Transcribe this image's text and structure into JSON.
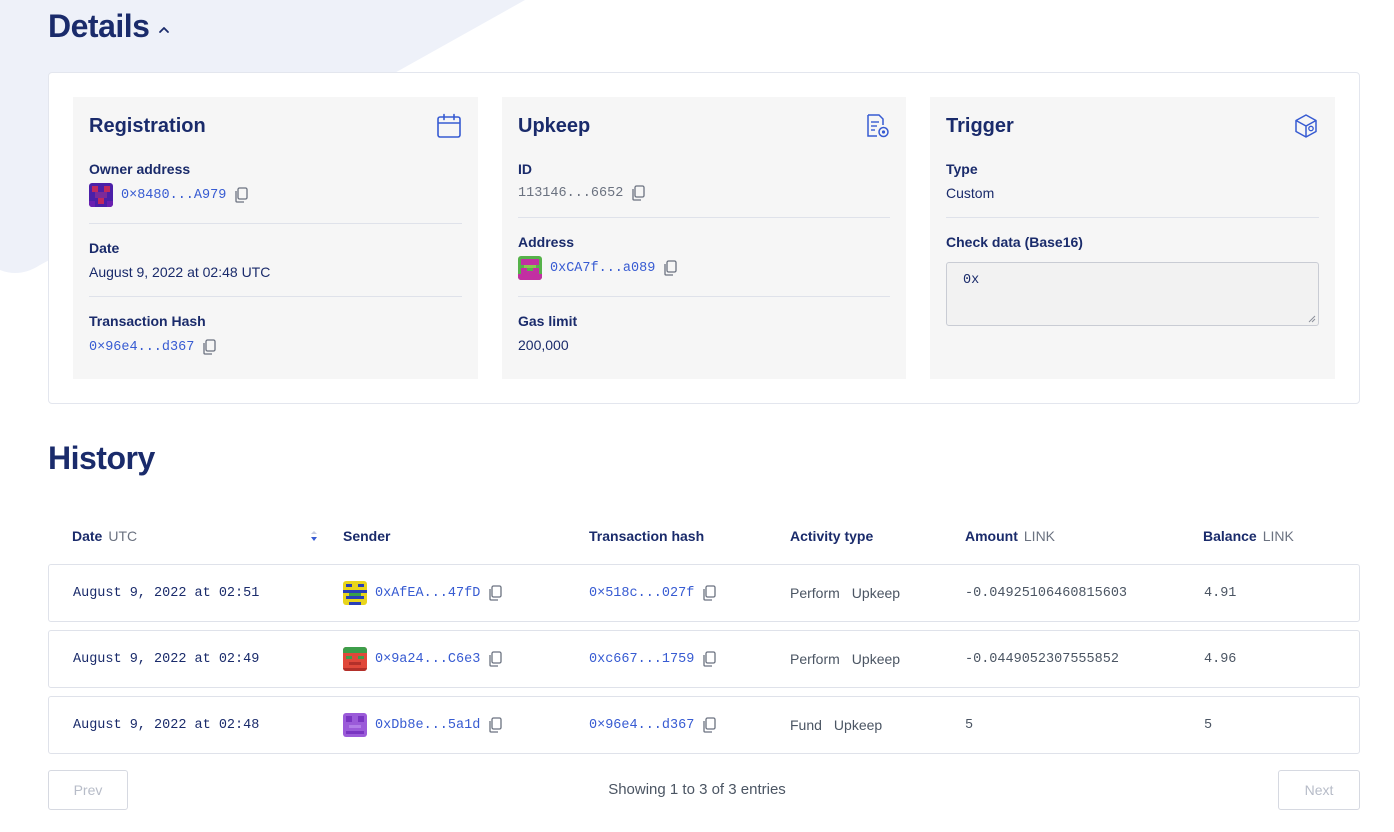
{
  "details": {
    "title": "Details",
    "registration": {
      "title": "Registration",
      "owner_label": "Owner address",
      "owner_value": "0×8480...A979",
      "date_label": "Date",
      "date_value": "August 9, 2022 at 02:48 UTC",
      "tx_label": "Transaction Hash",
      "tx_value": "0×96e4...d367"
    },
    "upkeep": {
      "title": "Upkeep",
      "id_label": "ID",
      "id_value": "113146...6652",
      "address_label": "Address",
      "address_value": "0xCA7f...a089",
      "gas_label": "Gas limit",
      "gas_value": "200,000"
    },
    "trigger": {
      "title": "Trigger",
      "type_label": "Type",
      "type_value": "Custom",
      "check_label": "Check data (Base16)",
      "check_value": "0x"
    }
  },
  "history": {
    "title": "History",
    "columns": {
      "date": "Date",
      "date_unit": "UTC",
      "sender": "Sender",
      "hash": "Transaction hash",
      "activity": "Activity type",
      "amount": "Amount",
      "amount_unit": "LINK",
      "balance": "Balance",
      "balance_unit": "LINK"
    },
    "rows": [
      {
        "date": "August 9, 2022 at 02:51",
        "sender": "0xAfEA...47fD",
        "hash": "0×518c...027f",
        "activity_1": "Perform",
        "activity_2": "Upkeep",
        "amount": "-0.04925106460815603",
        "balance": "4.91"
      },
      {
        "date": "August 9, 2022 at 02:49",
        "sender": "0×9a24...C6e3",
        "hash": "0xc667...1759",
        "activity_1": "Perform",
        "activity_2": "Upkeep",
        "amount": "-0.0449052307555852",
        "balance": "4.96"
      },
      {
        "date": "August 9, 2022 at 02:48",
        "sender": "0xDb8e...5a1d",
        "hash": "0×96e4...d367",
        "activity_1": "Fund",
        "activity_2": "Upkeep",
        "amount": "5",
        "balance": "5"
      }
    ],
    "pagination": {
      "prev": "Prev",
      "next": "Next",
      "showing": "Showing 1 to 3 of 3 entries"
    }
  },
  "colors": {
    "title": "#1a2b6b",
    "link": "#375bd2",
    "card_bg": "#f6f6f6",
    "bg_shape": "#eef1f9"
  },
  "icons": [
    "chevron-up-icon",
    "calendar-icon",
    "document-gear-icon",
    "cube-icon",
    "copy-icon",
    "sort-down-icon"
  ]
}
